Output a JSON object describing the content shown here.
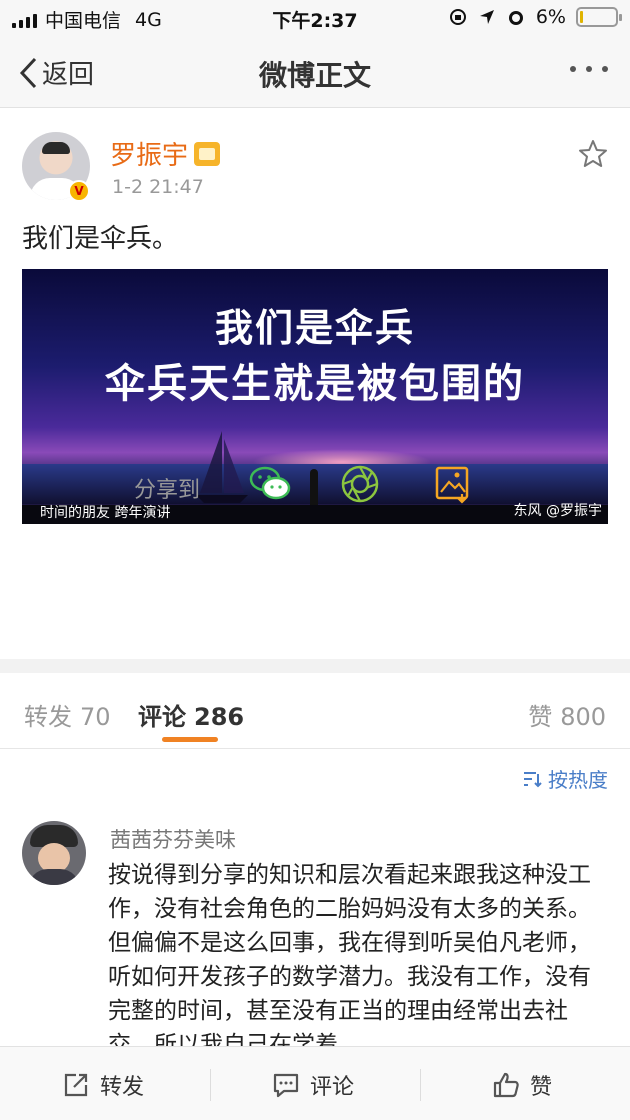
{
  "status_bar": {
    "carrier": "中国电信",
    "network": "4G",
    "time": "下午2:37",
    "battery": "6%",
    "battery_level": 0.06
  },
  "nav": {
    "back_label": "返回",
    "title": "微博正文"
  },
  "post": {
    "username": "罗振宇",
    "verified_badge": "V",
    "time": "1-2 21:47",
    "text": "我们是伞兵。",
    "image": {
      "headline_1": "我们是伞兵",
      "headline_2": "伞兵天生就是被包围的",
      "watermark_left": "时间的朋友 跨年演讲",
      "watermark_right": "东风 @罗振宇"
    }
  },
  "share": {
    "label": "分享到",
    "targets": [
      "wechat-icon",
      "moments-icon",
      "save-image-icon"
    ],
    "colors": {
      "wechat": "#3dbb55",
      "moments": "#8cc63f",
      "save": "#f5a623"
    }
  },
  "tabs": [
    {
      "label": "转发",
      "count": "70"
    },
    {
      "label": "评论",
      "count": "286"
    },
    {
      "label": "赞",
      "count": "800"
    }
  ],
  "sort_label": "按热度",
  "comments": [
    {
      "name": "茜茜芬芬美味",
      "text": "按说得到分享的知识和层次看起来跟我这种没工作，没有社会角色的二胎妈妈没有太多的关系。但偏偏不是这么回事，我在得到听吴伯凡老师，听如何开发孩子的数学潜力。我没有工作，没有完整的时间，甚至没有正当的理由经常出去社交，所以我自己在学着"
    }
  ],
  "bottom_bar": {
    "repost_label": "转发",
    "comment_label": "评论",
    "like_label": "赞"
  },
  "colors": {
    "accent_orange": "#f08223",
    "username_orange": "#e86b16",
    "link_blue": "#4a7ec8"
  }
}
